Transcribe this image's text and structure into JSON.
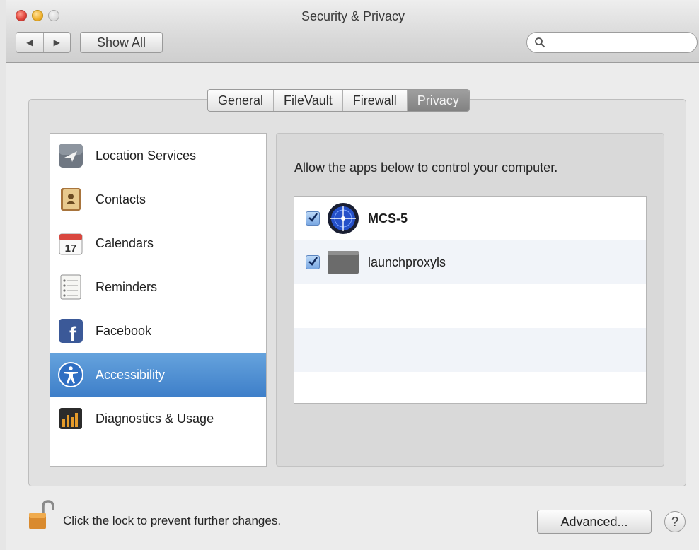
{
  "window": {
    "title": "Security & Privacy",
    "back_icon": "◀",
    "forward_icon": "▶",
    "show_all_label": "Show All",
    "search_placeholder": "",
    "search_value": ""
  },
  "tabs": [
    {
      "label": "General",
      "active": false
    },
    {
      "label": "FileVault",
      "active": false
    },
    {
      "label": "Firewall",
      "active": false
    },
    {
      "label": "Privacy",
      "active": true
    }
  ],
  "categories": [
    {
      "label": "Location Services",
      "icon": "location-services-icon",
      "selected": false
    },
    {
      "label": "Contacts",
      "icon": "contacts-icon",
      "selected": false
    },
    {
      "label": "Calendars",
      "icon": "calendar-icon",
      "selected": false,
      "icon_text": "17"
    },
    {
      "label": "Reminders",
      "icon": "reminders-icon",
      "selected": false
    },
    {
      "label": "Facebook",
      "icon": "facebook-icon",
      "selected": false,
      "icon_text": "f"
    },
    {
      "label": "Accessibility",
      "icon": "accessibility-icon",
      "selected": true
    },
    {
      "label": "Diagnostics & Usage",
      "icon": "diagnostics-icon",
      "selected": false
    }
  ],
  "panel": {
    "description": "Allow the apps below to control your computer.",
    "apps": [
      {
        "name": "MCS-5",
        "checked": true,
        "icon": "mcs5-app-icon"
      },
      {
        "name": "launchproxyls",
        "checked": true,
        "icon": "generic-app-icon"
      }
    ]
  },
  "footer": {
    "lock_text": "Click the lock to prevent further changes.",
    "advanced_label": "Advanced...",
    "help_label": "?"
  },
  "colors": {
    "selection": "#3e7fc9",
    "active_tab": "#8a8a8a"
  }
}
